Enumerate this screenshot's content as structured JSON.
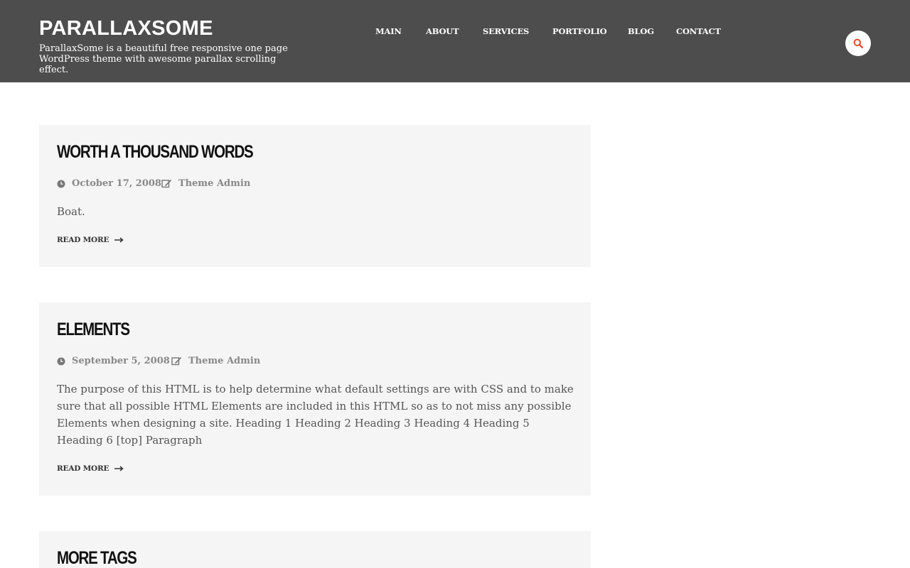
{
  "site": {
    "title": "PARALLAXSOME",
    "description": "ParallaxSome is a beautiful free responsive one page WordPress theme with awesome parallax scrolling effect."
  },
  "nav": {
    "items": [
      {
        "label": "MAIN"
      },
      {
        "label": "ABOUT"
      },
      {
        "label": "SERVICES"
      },
      {
        "label": "PORTFOLIO"
      },
      {
        "label": "BLOG"
      },
      {
        "label": "CONTACT"
      }
    ],
    "search_icon": "search-icon"
  },
  "posts": [
    {
      "title": "Worth A Thousand Words",
      "date": "October 17, 2008",
      "author": "Theme Admin",
      "excerpt": "Boat.",
      "read_more": "READ MORE"
    },
    {
      "title": "Elements",
      "date": "September 5, 2008",
      "author": "Theme Admin",
      "excerpt": "The purpose of this HTML is to help determine what default settings are with CSS and to make sure that all possible HTML Elements are included in this HTML so as to not miss any possible Elements when designing a site. Heading 1 Heading 2 Heading 3 Heading 4 Heading 5 Heading 6 [top] Paragraph",
      "read_more": "READ MORE"
    },
    {
      "title": "More Tags"
    }
  ],
  "colors": {
    "header_bg": "#4d4d4d",
    "accent": "#e14b2a",
    "post_bg": "#f5f5f5"
  }
}
